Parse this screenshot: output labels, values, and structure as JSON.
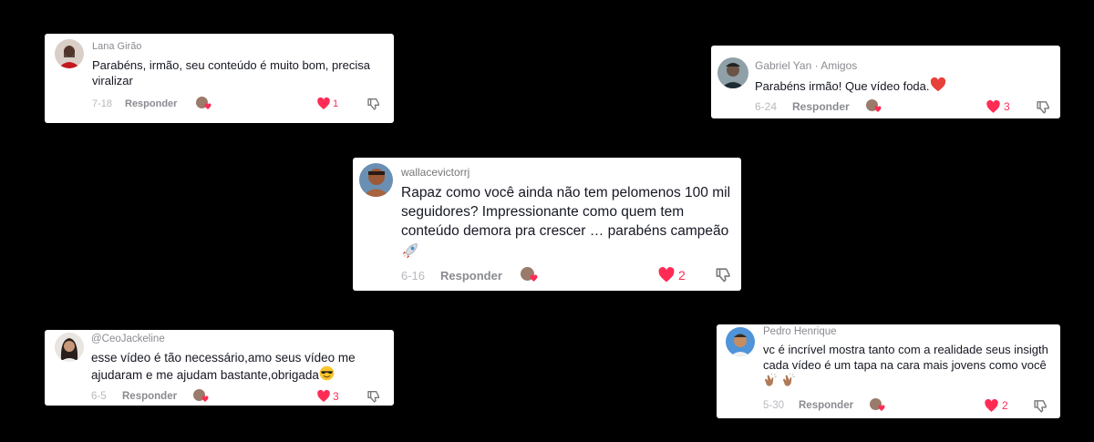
{
  "comments": [
    {
      "username": "Lana Girão",
      "text": "Parabéns, irmão, seu conteúdo é muito bom, precisa viralizar",
      "date": "7-18",
      "reply": "Responder",
      "likes": "1",
      "dislike_icon": "thumbs-down-icon"
    },
    {
      "username": "Gabriel Yan · Amigos",
      "text": "Parabéns irmão! Que vídeo foda.",
      "text_emoji": "red-heart",
      "date": "6-24",
      "reply": "Responder",
      "likes": "3",
      "dislike_icon": "thumbs-down-icon"
    },
    {
      "username": "wallacevictorrj",
      "text": "Rapaz como você ainda não tem pelomenos 100 mil seguidores? Impressionante como quem tem conteúdo demora pra crescer … parabéns campeão",
      "text_emoji": "rocket",
      "date": "6-16",
      "reply": "Responder",
      "likes": "2",
      "dislike_icon": "thumbs-down-icon"
    },
    {
      "username": "@CeoJackeline",
      "text": "esse vídeo é tão necessário,amo seus vídeo me ajudaram e me ajudam bastante,obrigada",
      "text_emoji": "smiling-face-with-sunglasses",
      "date": "6-5",
      "reply": "Responder",
      "likes": "3",
      "dislike_icon": "thumbs-down-icon"
    },
    {
      "username": "Pedro Henrique",
      "text": "vc é incrível mostra tanto com a realidade seus insigth cada vídeo é um tapa na cara mais jovens como você",
      "text_emoji": "clapping-hands",
      "date": "5-30",
      "reply": "Responder",
      "likes": "2",
      "dislike_icon": "thumbs-down-icon"
    }
  ],
  "colors": {
    "background": "#000000",
    "card": "#ffffff",
    "like": "#fe2c55",
    "username": "#8a8b91",
    "text": "#161823"
  }
}
